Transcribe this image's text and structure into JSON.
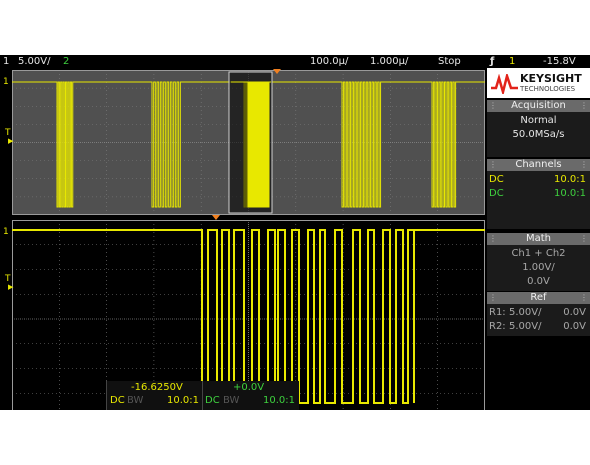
{
  "status_bar": {
    "ch1_num": "1",
    "ch1_scale": "5.00V/",
    "ch2_num": "2",
    "time_scale": "100.0µ/",
    "delay": "1.000µ/",
    "run_state": "Stop",
    "trigger_icon": "ƒ",
    "trigger_ch": "1",
    "trigger_level": "-15.8V"
  },
  "brand": {
    "name": "KEYSIGHT",
    "sub": "TECHNOLOGIES"
  },
  "acquisition": {
    "title": "Acquisition",
    "mode": "Normal",
    "rate": "50.0MSa/s"
  },
  "channels": {
    "title": "Channels",
    "rows": [
      {
        "coupling": "DC",
        "probe": "10.0:1"
      },
      {
        "coupling": "DC",
        "probe": "10.0:1"
      }
    ]
  },
  "math": {
    "title": "Math",
    "func": "Ch1 + Ch2",
    "scale": "1.00V/",
    "offset": "0.0V"
  },
  "ref": {
    "title": "Ref",
    "rows": [
      {
        "label": "R1:",
        "scale": "5.00V/",
        "offset": "0.0V"
      },
      {
        "label": "R2:",
        "scale": "5.00V/",
        "offset": "0.0V"
      }
    ]
  },
  "bottom": {
    "ch1_offset": "-16.6250V",
    "ch2_offset": "+0.0V",
    "ch1_coupling": "DC",
    "ch1_bw": "BW",
    "ch1_probe": "10.0:1",
    "ch2_coupling": "DC",
    "ch2_bw": "BW",
    "ch2_probe": "10.0:1"
  },
  "markers": {
    "ground_1": "1",
    "trigger_t": "T"
  },
  "colors": {
    "ch1": "#e8e800",
    "ch2": "#3ed03e",
    "grid": "#8a8a8a",
    "upper_bg": "#505050"
  }
}
